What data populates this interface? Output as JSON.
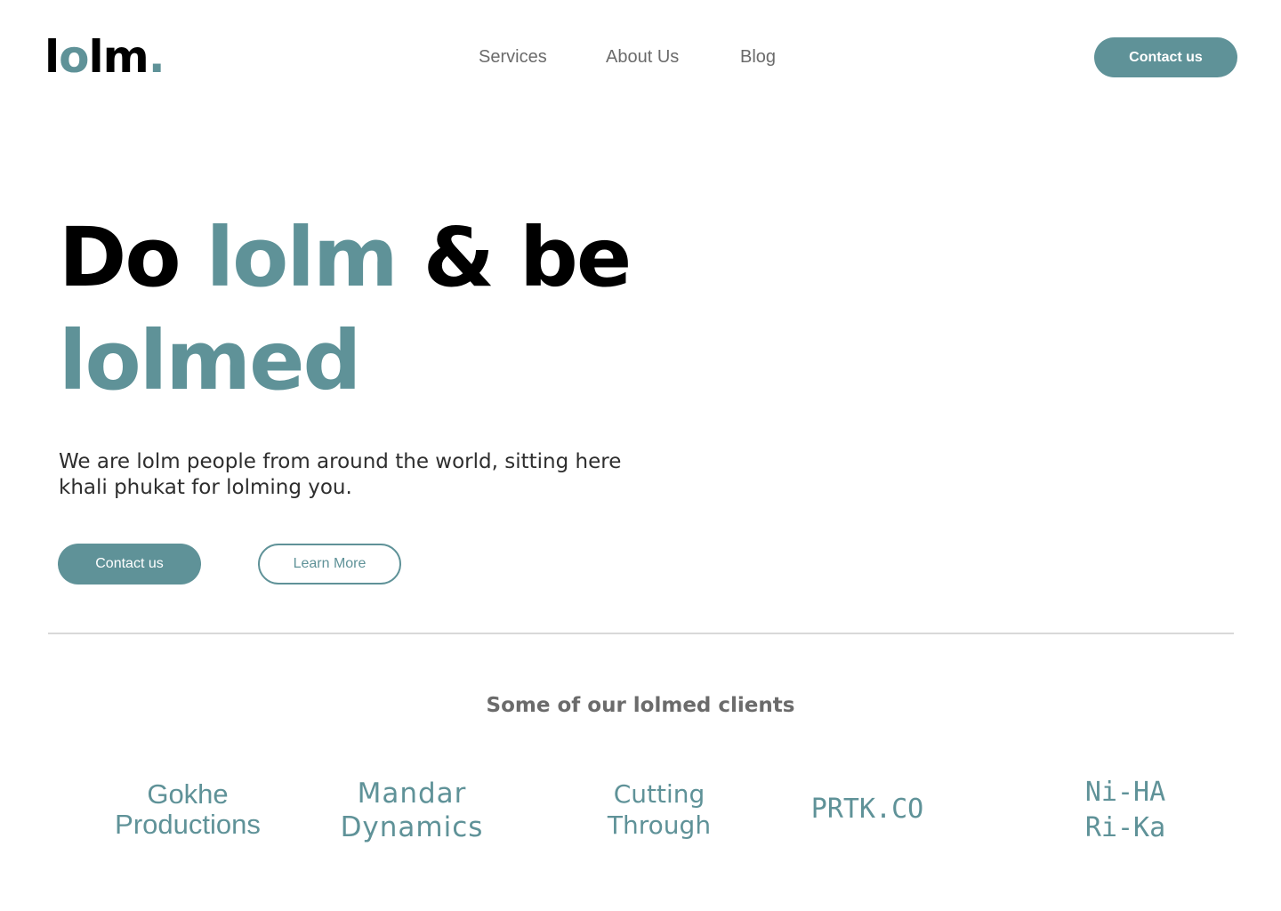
{
  "header": {
    "logo": {
      "part1": "l",
      "part2": "o",
      "part3": "lm",
      "dot": "."
    },
    "nav": [
      {
        "label": "Services"
      },
      {
        "label": "About Us"
      },
      {
        "label": "Blog"
      }
    ],
    "contact_label": "Contact us"
  },
  "hero": {
    "title_line1_prefix": "Do ",
    "title_line1_accent": "lolm",
    "title_line1_suffix": " & be",
    "title_line2_accent": "lolmed",
    "description": "We are lolm people from around the world, sitting here khali phukat for lolming you.",
    "contact_label": "Contact us",
    "learn_more_label": "Learn More"
  },
  "clients": {
    "heading": "Some of our lolmed clients",
    "items": [
      {
        "line1": "Gokhe",
        "line2": "Productions"
      },
      {
        "line1": "Mandar",
        "line2": "Dynamics"
      },
      {
        "line1": "Cutting",
        "line2": "Through"
      },
      {
        "line1": "PRTK.CO",
        "line2": ""
      },
      {
        "line1": "Ni-HA",
        "line2": "Ri-Ka"
      }
    ]
  },
  "colors": {
    "accent": "#5f9298",
    "text_dark": "#000000",
    "text_muted": "#6b6b6b",
    "divider": "#d9d9d9"
  }
}
